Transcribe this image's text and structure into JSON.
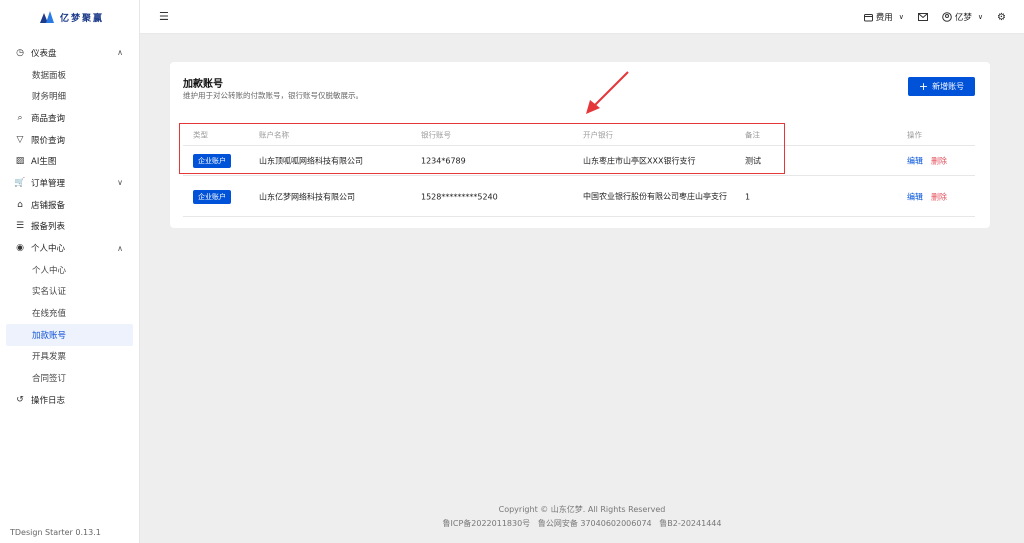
{
  "app": {
    "logo_text": "亿梦聚赢",
    "version": "TDesign Starter 0.13.1"
  },
  "sidebar": {
    "groups": [
      {
        "icon": "dashboard-icon",
        "glyph": "◷",
        "label": "仪表盘",
        "expanded": true,
        "children": [
          "数据面板",
          "财务明细"
        ]
      },
      {
        "icon": "search-icon",
        "glyph": "⌕",
        "label": "商品查询"
      },
      {
        "icon": "filter-icon",
        "glyph": "▽",
        "label": "限价查询"
      },
      {
        "icon": "image-icon",
        "glyph": "▨",
        "label": "AI生图"
      },
      {
        "icon": "cart-icon",
        "glyph": "🛒",
        "label": "订单管理",
        "expanded": false
      },
      {
        "icon": "shop-icon",
        "glyph": "⌂",
        "label": "店铺报备"
      },
      {
        "icon": "list-icon",
        "glyph": "☰",
        "label": "报备列表"
      },
      {
        "icon": "user-circle-icon",
        "glyph": "◉",
        "label": "个人中心",
        "expanded": true,
        "children": [
          "个人中心",
          "实名认证",
          "在线充值",
          "加款账号",
          "开具发票",
          "合同签订"
        ]
      },
      {
        "icon": "history-icon",
        "glyph": "↺",
        "label": "操作日志"
      }
    ],
    "active_item": "加款账号"
  },
  "header": {
    "cost_label": "费用",
    "user_label": "亿梦"
  },
  "page": {
    "title": "加款账号",
    "description": "维护用于对公转账的付款账号，银行账号仅脱敏展示。",
    "add_button": "新增账号"
  },
  "table": {
    "columns": [
      "类型",
      "账户名称",
      "银行账号",
      "开户银行",
      "备注",
      "操作"
    ],
    "rows": [
      {
        "type": "企业账户",
        "name": "山东顶呱呱网络科技有限公司",
        "account": "1234*6789",
        "bank": "山东枣庄市山亭区XXX银行支行",
        "note": "测试",
        "edit": "编辑",
        "delete": "删除"
      },
      {
        "type": "企业账户",
        "name": "山东亿梦网络科技有限公司",
        "account": "1528*********5240",
        "bank": "中国农业银行股份有限公司枣庄山亭支行",
        "note": "1",
        "edit": "编辑",
        "delete": "删除"
      }
    ]
  },
  "footer": {
    "copyright": "Copyright © 山东亿梦. All Rights Reserved",
    "icp": "鲁ICP备2022011830号",
    "police": "鲁公网安备 37040602006074",
    "b2": "鲁B2-20241444"
  },
  "colors": {
    "brand": "#0052d9",
    "danger": "#e34d59",
    "annotation": "#e5363a"
  }
}
